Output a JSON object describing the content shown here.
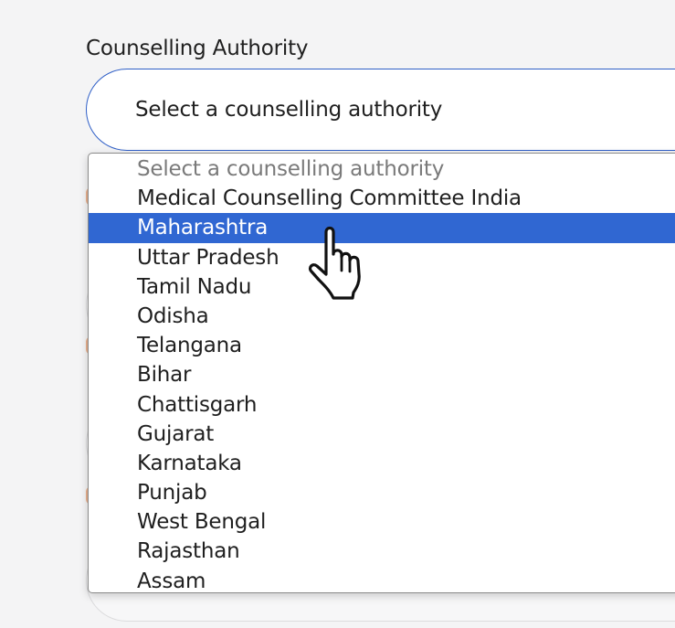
{
  "field": {
    "label": "Counselling Authority",
    "selected_value": "Select a counselling authority"
  },
  "dropdown": {
    "options": [
      "Select a counselling authority",
      "Medical Counselling Committee India",
      "Maharashtra",
      "Uttar Pradesh",
      "Tamil Nadu",
      "Odisha",
      "Telangana",
      "Bihar",
      "Chattisgarh",
      "Gujarat",
      "Karnataka",
      "Punjab",
      "West Bengal",
      "Rajasthan",
      "Assam"
    ],
    "highlighted_option": "Maharashtra"
  },
  "colors": {
    "highlight": "#3067d2",
    "focus_border": "#2f5fc7",
    "background": "#f4f4f5"
  },
  "icons": {
    "cursor": "hand-pointer-icon"
  }
}
